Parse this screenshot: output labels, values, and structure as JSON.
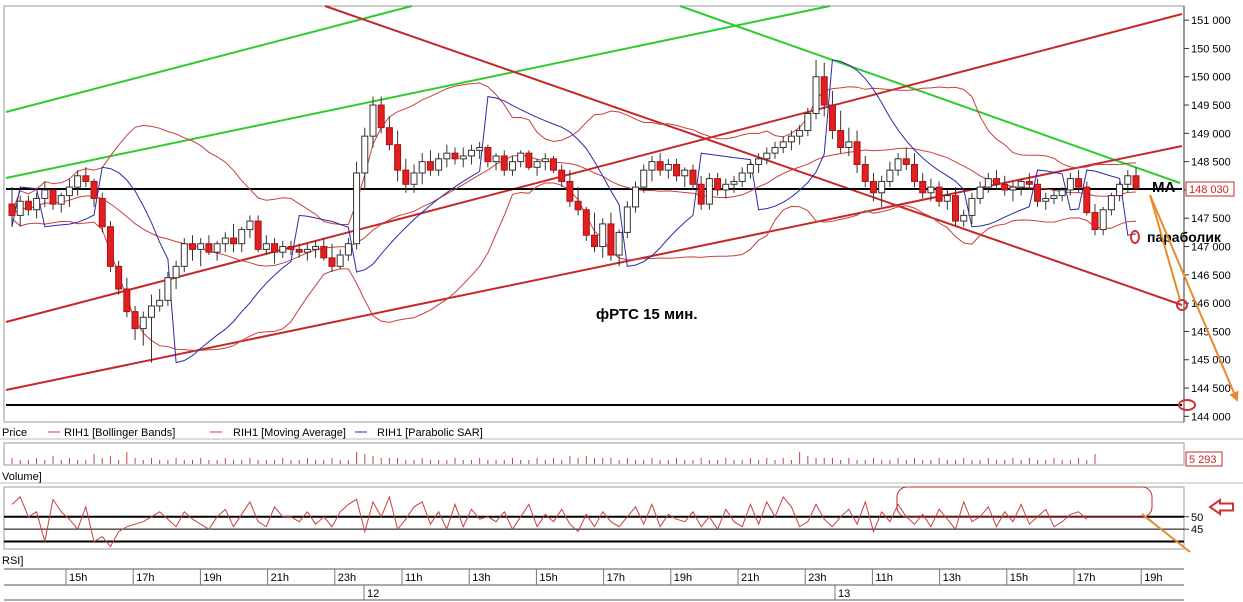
{
  "chart_data": {
    "type": "candlestick",
    "title": "фРТС   15 мин.",
    "ylim": [
      143900,
      151250
    ],
    "y_ticks": [
      144000,
      144500,
      145000,
      145500,
      146000,
      146500,
      147000,
      147500,
      148000,
      148500,
      149000,
      149500,
      150000,
      150500,
      151000
    ],
    "y_tick_labels": [
      "144 000",
      "144 500",
      "145 000",
      "145 500",
      "146 000",
      "146 500",
      "147 000",
      "147 500",
      "148 000",
      "148 500",
      "149 000",
      "149 500",
      "150 000",
      "150 500",
      "151 000"
    ],
    "last_price_label": "148 030",
    "last_price": 148030,
    "x_time_labels": [
      "15h",
      "17h",
      "19h",
      "21h",
      "23h",
      "11h",
      "13h",
      "15h",
      "17h",
      "19h",
      "21h",
      "23h",
      "11h",
      "13h",
      "15h",
      "17h",
      "19h"
    ],
    "date_labels": [
      "12",
      "13"
    ],
    "price_panel_label": "Price",
    "legend": [
      {
        "name": "RIH1 [Bollinger Bands]",
        "color": "#c84040"
      },
      {
        "name": "RIH1 [Moving Average]",
        "color": "#c84040"
      },
      {
        "name": "RIH1 [Parabolic SAR]",
        "color": "#2a2aa8"
      }
    ],
    "volume_panel_label": "Volume]",
    "volume_last_label": "5 293",
    "rsi_panel_label": "RSI]",
    "rsi_ticks": [
      "50",
      "45"
    ],
    "annotations": {
      "ma": "МА",
      "parabolic": "параболик"
    },
    "candles": [
      [
        147750,
        148050,
        147350,
        147550
      ],
      [
        147550,
        147900,
        147350,
        147800
      ],
      [
        147800,
        147900,
        147550,
        147650
      ],
      [
        147650,
        147950,
        147500,
        147850
      ],
      [
        147850,
        148150,
        147700,
        148000
      ],
      [
        148000,
        148000,
        147650,
        147750
      ],
      [
        147750,
        147950,
        147600,
        147900
      ],
      [
        147900,
        148200,
        147700,
        148050
      ],
      [
        148050,
        148350,
        147900,
        148250
      ],
      [
        148250,
        148400,
        148050,
        148150
      ],
      [
        148150,
        148200,
        147700,
        147850
      ],
      [
        147850,
        147950,
        147250,
        147350
      ],
      [
        147350,
        147450,
        146550,
        146650
      ],
      [
        146650,
        146750,
        146150,
        146250
      ],
      [
        146250,
        146450,
        145750,
        145850
      ],
      [
        145850,
        145950,
        145350,
        145550
      ],
      [
        145550,
        145850,
        145250,
        145750
      ],
      [
        145750,
        146150,
        144950,
        145950
      ],
      [
        145950,
        146250,
        145850,
        146050
      ],
      [
        146050,
        146550,
        145950,
        146450
      ],
      [
        146450,
        146750,
        146250,
        146650
      ],
      [
        146650,
        147150,
        146550,
        147050
      ],
      [
        147050,
        147200,
        146750,
        146950
      ],
      [
        146950,
        147150,
        146650,
        147050
      ],
      [
        147050,
        147200,
        146850,
        146900
      ],
      [
        146900,
        147100,
        146750,
        147050
      ],
      [
        147050,
        147250,
        146900,
        147150
      ],
      [
        147150,
        147400,
        146900,
        147050
      ],
      [
        147050,
        147350,
        146900,
        147300
      ],
      [
        147300,
        147550,
        147150,
        147450
      ],
      [
        147450,
        147550,
        146900,
        146950
      ],
      [
        146950,
        147200,
        146850,
        147050
      ],
      [
        147050,
        147150,
        146700,
        146900
      ],
      [
        146900,
        147100,
        146800,
        147000
      ],
      [
        147000,
        147100,
        146850,
        146950
      ],
      [
        146950,
        147050,
        146800,
        146900
      ],
      [
        146900,
        147050,
        146750,
        146950
      ],
      [
        146950,
        147100,
        146800,
        147000
      ],
      [
        147000,
        147150,
        146750,
        146800
      ],
      [
        146800,
        147050,
        146550,
        146650
      ],
      [
        146650,
        146950,
        146600,
        146850
      ],
      [
        146850,
        147150,
        146750,
        147050
      ],
      [
        147050,
        148500,
        146950,
        148300
      ],
      [
        148300,
        149100,
        148000,
        148950
      ],
      [
        148950,
        149650,
        148750,
        149500
      ],
      [
        149500,
        149650,
        149000,
        149100
      ],
      [
        149100,
        149300,
        148700,
        148800
      ],
      [
        148800,
        149050,
        148150,
        148350
      ],
      [
        148350,
        148550,
        147950,
        148100
      ],
      [
        148100,
        148450,
        147950,
        148300
      ],
      [
        148300,
        148650,
        148100,
        148500
      ],
      [
        148500,
        148700,
        148250,
        148350
      ],
      [
        148350,
        148650,
        148250,
        148550
      ],
      [
        148550,
        148800,
        148400,
        148650
      ],
      [
        148650,
        148750,
        148450,
        148550
      ],
      [
        148550,
        148750,
        148400,
        148600
      ],
      [
        148600,
        148800,
        148450,
        148700
      ],
      [
        148700,
        148850,
        148550,
        148750
      ],
      [
        148750,
        148800,
        148400,
        148500
      ],
      [
        148500,
        148650,
        148350,
        148600
      ],
      [
        148600,
        148700,
        148250,
        148350
      ],
      [
        148350,
        148600,
        148250,
        148500
      ],
      [
        148500,
        148700,
        148400,
        148650
      ],
      [
        148650,
        148700,
        148350,
        148400
      ],
      [
        148400,
        148550,
        148250,
        148500
      ],
      [
        148500,
        148650,
        148350,
        148550
      ],
      [
        148550,
        148600,
        148300,
        148350
      ],
      [
        148350,
        148450,
        148050,
        148150
      ],
      [
        148150,
        148350,
        147700,
        147800
      ],
      [
        147800,
        148050,
        147550,
        147650
      ],
      [
        147650,
        147700,
        147100,
        147200
      ],
      [
        147200,
        147600,
        146900,
        147000
      ],
      [
        147000,
        147500,
        146800,
        147400
      ],
      [
        147400,
        147600,
        146750,
        146850
      ],
      [
        146850,
        147300,
        146650,
        147250
      ],
      [
        147250,
        147800,
        147150,
        147700
      ],
      [
        147700,
        148150,
        147600,
        148050
      ],
      [
        148050,
        148450,
        147950,
        148350
      ],
      [
        148350,
        148600,
        148150,
        148500
      ],
      [
        148500,
        148650,
        148250,
        148350
      ],
      [
        148350,
        148550,
        148200,
        148450
      ],
      [
        148450,
        148550,
        148150,
        148250
      ],
      [
        148250,
        148400,
        148050,
        148350
      ],
      [
        148350,
        148450,
        148000,
        148100
      ],
      [
        148100,
        148250,
        147650,
        147750
      ],
      [
        147750,
        148300,
        147650,
        148200
      ],
      [
        148200,
        148300,
        147900,
        148000
      ],
      [
        148000,
        148200,
        147850,
        148100
      ],
      [
        148100,
        148250,
        147950,
        148150
      ],
      [
        148150,
        148400,
        148050,
        148300
      ],
      [
        148300,
        148500,
        148200,
        148450
      ],
      [
        148450,
        148650,
        148300,
        148550
      ],
      [
        148550,
        148750,
        148450,
        148650
      ],
      [
        148650,
        148850,
        148550,
        148750
      ],
      [
        148750,
        148950,
        148650,
        148850
      ],
      [
        148850,
        149050,
        148700,
        148950
      ],
      [
        148950,
        149150,
        148800,
        149050
      ],
      [
        149050,
        149450,
        148950,
        149350
      ],
      [
        149350,
        150300,
        149250,
        150000
      ],
      [
        150000,
        150250,
        149300,
        149500
      ],
      [
        149500,
        149750,
        148900,
        149050
      ],
      [
        149050,
        149400,
        148650,
        148750
      ],
      [
        148750,
        149100,
        148600,
        148850
      ],
      [
        148850,
        149050,
        148300,
        148450
      ],
      [
        148450,
        148600,
        148050,
        148150
      ],
      [
        148150,
        148300,
        147800,
        147950
      ],
      [
        147950,
        148250,
        147700,
        148150
      ],
      [
        148150,
        148500,
        148050,
        148350
      ],
      [
        148350,
        148650,
        148250,
        148550
      ],
      [
        148550,
        148750,
        148350,
        148450
      ],
      [
        148450,
        148650,
        148050,
        148150
      ],
      [
        148150,
        148300,
        147850,
        147950
      ],
      [
        147950,
        148200,
        147800,
        148050
      ],
      [
        148050,
        148150,
        147700,
        147800
      ],
      [
        147800,
        148000,
        147650,
        147900
      ],
      [
        147900,
        148050,
        147350,
        147450
      ],
      [
        147450,
        147650,
        147350,
        147550
      ],
      [
        147550,
        147950,
        147400,
        147850
      ],
      [
        147850,
        148150,
        147750,
        148050
      ],
      [
        148050,
        148300,
        147950,
        148200
      ],
      [
        148200,
        148350,
        148000,
        148100
      ],
      [
        148100,
        148250,
        147900,
        148000
      ],
      [
        148000,
        148150,
        147800,
        148050
      ],
      [
        148050,
        148200,
        147900,
        148150
      ],
      [
        148150,
        148300,
        148000,
        148100
      ],
      [
        148100,
        148200,
        147700,
        147800
      ],
      [
        147800,
        147950,
        147650,
        147850
      ],
      [
        147850,
        148000,
        147750,
        147900
      ],
      [
        147900,
        148050,
        147800,
        148000
      ],
      [
        148000,
        148300,
        147900,
        148200
      ],
      [
        148200,
        148350,
        147950,
        148050
      ],
      [
        148050,
        148150,
        147550,
        147600
      ],
      [
        147600,
        147750,
        147200,
        147300
      ],
      [
        147300,
        147700,
        147200,
        147650
      ],
      [
        147650,
        147950,
        147550,
        147900
      ],
      [
        147900,
        148150,
        147800,
        148100
      ],
      [
        148100,
        148350,
        147950,
        148250
      ],
      [
        148250,
        148400,
        148050,
        148030
      ]
    ],
    "rsi_values": [
      55,
      58,
      50,
      52,
      40,
      57,
      52,
      49,
      45,
      54,
      40,
      42,
      38,
      44,
      46,
      47,
      48,
      50,
      52,
      49,
      46,
      52,
      49,
      47,
      45,
      50,
      53,
      46,
      51,
      56,
      48,
      46,
      54,
      50,
      50,
      48,
      52,
      47,
      50,
      46,
      52,
      55,
      57,
      44,
      56,
      50,
      58,
      45,
      49,
      54,
      56,
      47,
      52,
      45,
      55,
      46,
      53,
      49,
      50,
      48,
      52,
      45,
      50,
      55,
      46,
      51,
      48,
      53,
      47,
      44,
      51,
      46,
      52,
      48,
      46,
      50,
      54,
      47,
      55,
      46,
      51,
      49,
      48,
      52,
      46,
      50,
      45,
      53,
      48,
      46,
      55,
      47,
      56,
      50,
      58,
      54,
      46,
      48,
      55,
      49,
      46,
      50,
      53,
      47,
      56,
      44,
      52,
      48,
      55,
      50,
      47,
      51,
      46,
      53,
      49,
      45,
      56,
      48,
      50,
      54,
      46,
      52,
      48,
      55,
      47,
      50,
      53,
      46,
      48,
      51,
      52,
      49
    ],
    "volume_values": [
      3,
      2,
      2,
      3,
      2,
      4,
      2,
      3,
      2,
      2,
      5,
      3,
      4,
      2,
      6,
      3,
      2,
      3,
      2,
      2,
      3,
      2,
      2,
      3,
      2,
      2,
      3,
      2,
      2,
      3,
      2,
      2,
      2,
      3,
      2,
      2,
      3,
      2,
      2,
      3,
      2,
      2,
      6,
      5,
      4,
      3,
      3,
      3,
      2,
      2,
      3,
      2,
      2,
      2,
      3,
      2,
      2,
      3,
      2,
      2,
      2,
      3,
      2,
      2,
      3,
      2,
      3,
      2,
      4,
      3,
      4,
      3,
      3,
      3,
      2,
      3,
      2,
      2,
      3,
      2,
      2,
      3,
      2,
      2,
      3,
      2,
      2,
      3,
      2,
      2,
      3,
      2,
      3,
      2,
      3,
      2,
      6,
      4,
      3,
      3,
      3,
      2,
      3,
      2,
      2,
      3,
      2,
      2,
      3,
      2,
      3,
      2,
      2,
      3,
      2,
      2,
      3,
      2,
      2,
      3,
      2,
      2,
      3,
      2,
      3,
      2,
      2,
      3,
      2,
      2,
      3,
      2,
      5
    ]
  }
}
